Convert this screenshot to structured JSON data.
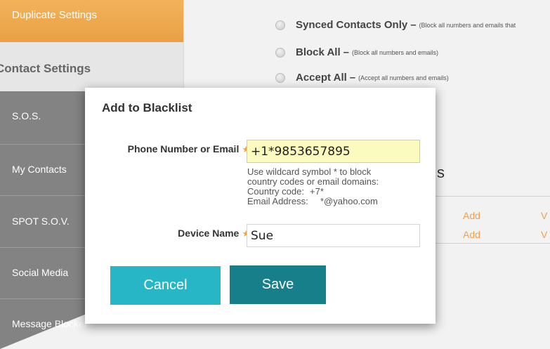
{
  "sidebar": {
    "duplicate_settings": "Duplicate Settings",
    "contact_settings": "Contact Settings",
    "items": [
      {
        "label": "S.O.S."
      },
      {
        "label": "My Contacts"
      },
      {
        "label": "SPOT S.O.V."
      },
      {
        "label": "Social Media"
      },
      {
        "label": "Message Blocker"
      }
    ]
  },
  "options": [
    {
      "title": "Synced Contacts Only",
      "dash": "–",
      "desc": "(Block all numbers and emails that"
    },
    {
      "title": "Block All",
      "dash": "–",
      "desc": "(Block all numbers and emails)"
    },
    {
      "title": "Accept All",
      "dash": "–",
      "desc": "(Accept all numbers and emails)"
    }
  ],
  "background": {
    "heading_fragment": "s",
    "links": [
      "Add",
      "V",
      "Add",
      "V"
    ]
  },
  "modal": {
    "title": "Add to Blacklist",
    "phone_label": "Phone Number or Email",
    "phone_value": "+1*9853657895",
    "hint_line1": "Use wildcard symbol * to block",
    "hint_line2": "country codes or email domains:",
    "hint_country_label": "Country code:",
    "hint_country_value": "+7*",
    "hint_email_label": "Email Address:",
    "hint_email_value": "*@yahoo.com",
    "device_label": "Device Name",
    "device_value": "Sue",
    "required_mark": "★",
    "cancel_label": "Cancel",
    "save_label": "Save"
  },
  "colors": {
    "accent_orange": "#e9a044",
    "sidebar_dark": "#838383",
    "cancel_button": "#27b6c5",
    "save_button": "#177f8a",
    "phone_field_bg": "#fbfbbf",
    "required_star": "#f2a33c"
  }
}
